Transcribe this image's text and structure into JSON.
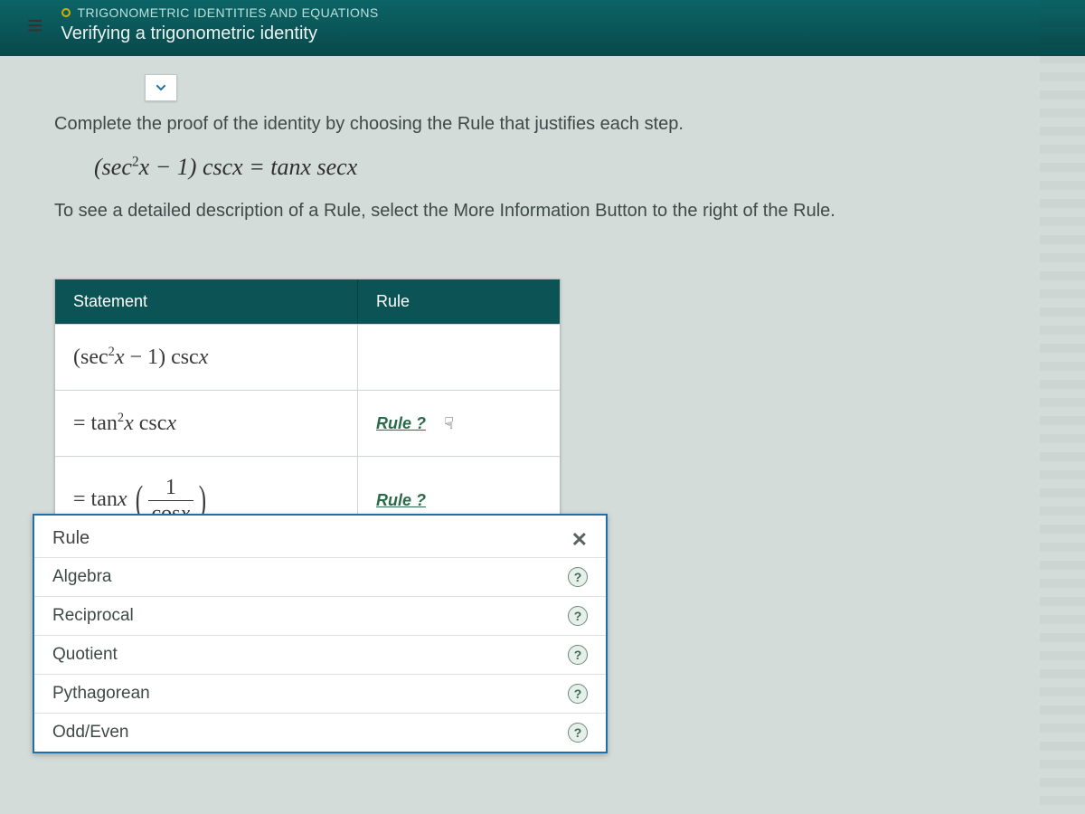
{
  "header": {
    "section": "TRIGONOMETRIC IDENTITIES AND EQUATIONS",
    "title": "Verifying a trigonometric identity"
  },
  "instructions": {
    "line1": "Complete the proof of the identity by choosing the Rule that justifies each step.",
    "identity_html": "(sec²x − 1) csc x = tan x sec x",
    "line2": "To see a detailed description of a Rule, select the More Information Button to the right of the Rule."
  },
  "proof": {
    "headers": {
      "statement": "Statement",
      "rule": "Rule"
    },
    "rows": [
      {
        "statement_html": "(sec²x − 1) csc x",
        "rule": ""
      },
      {
        "statement_html": "= tan²x csc x",
        "rule": "Rule ?"
      },
      {
        "statement_html": "= tan x ( 1 / cos x )",
        "rule": "Rule ?"
      }
    ]
  },
  "dropdown": {
    "heading": "Rule",
    "close": "✕",
    "options": [
      "Algebra",
      "Reciprocal",
      "Quotient",
      "Pythagorean",
      "Odd/Even"
    ],
    "info_glyph": "?"
  }
}
